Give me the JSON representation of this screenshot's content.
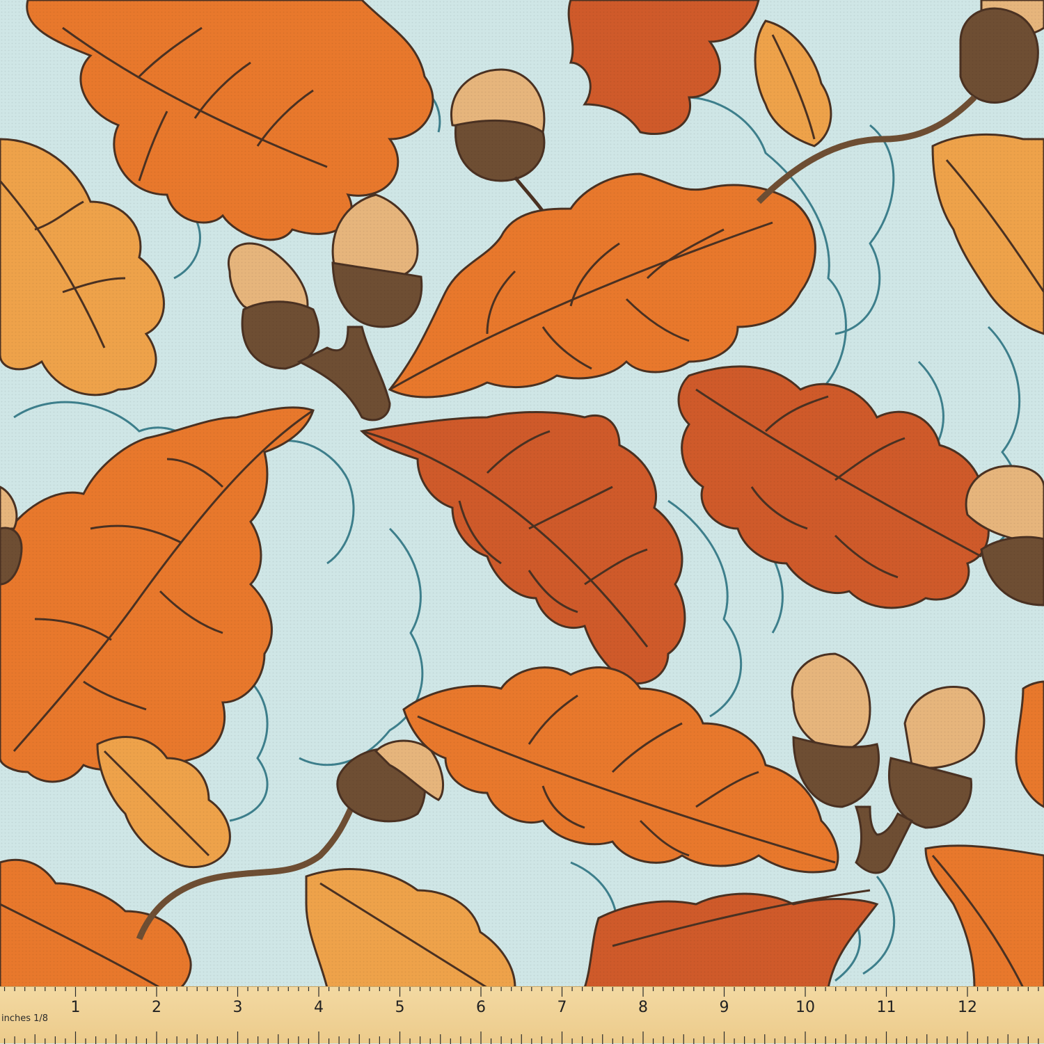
{
  "image": {
    "subject": "fabric-swatch",
    "pattern": "autumn-oak-leaves-and-acorns",
    "colors": {
      "background": "#cfe6e6",
      "outline_blue": "#3d7f8c",
      "leaf_orange": "#e8782c",
      "leaf_red": "#cf5a2a",
      "leaf_gold": "#eea24a",
      "vein": "#4a3122",
      "acorn_cap": "#6e4e33",
      "acorn_nut": "#e6b57c",
      "ruler": "#eccb8b"
    }
  },
  "ruler": {
    "unit_label": "inches 1/8",
    "numbers": [
      "1",
      "2",
      "3",
      "4",
      "5",
      "6",
      "7",
      "8",
      "9",
      "10",
      "11",
      "12",
      "1"
    ]
  }
}
